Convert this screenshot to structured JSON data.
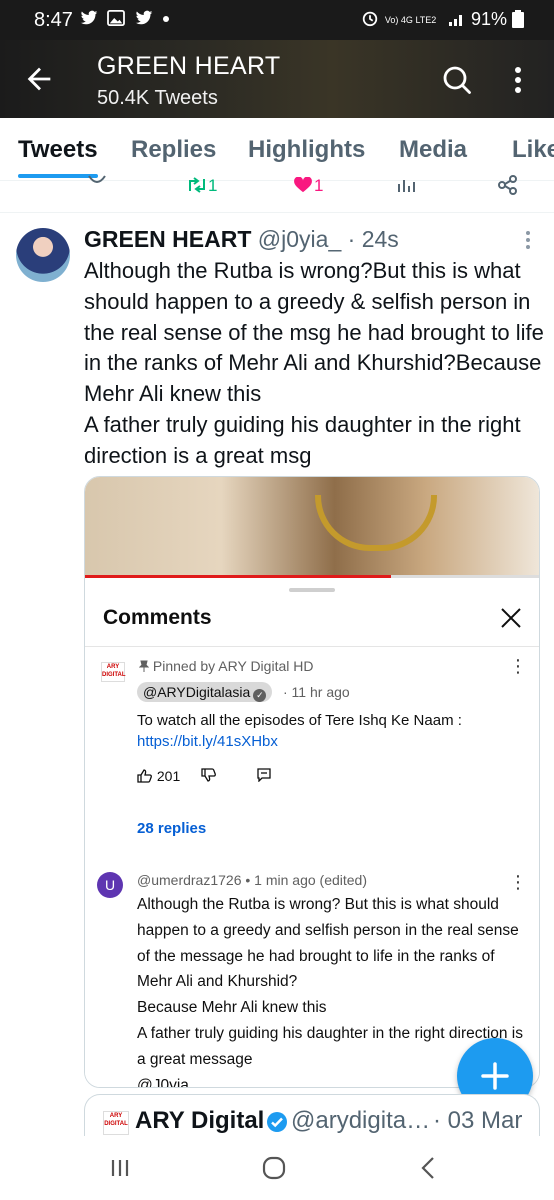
{
  "status_bar": {
    "time": "8:47",
    "notif_icons": [
      "twitter-icon",
      "gallery-icon",
      "twitter-icon",
      "dot-icon"
    ],
    "right": "91%",
    "network": "Vo) 4G LTE2"
  },
  "header": {
    "title": "GREEN HEART",
    "subtitle": "50.4K Tweets"
  },
  "tabs": [
    {
      "label": "Tweets",
      "active": true
    },
    {
      "label": "Replies",
      "active": false
    },
    {
      "label": "Highlights",
      "active": false
    },
    {
      "label": "Media",
      "active": false
    },
    {
      "label": "Likes",
      "active": false
    }
  ],
  "prev_actions": {
    "retweets": "1",
    "likes": "1"
  },
  "tweet": {
    "name": "GREEN HEART",
    "handle": "@j0yia_",
    "time": "· 24s",
    "text": "Although the Rutba is wrong?But this is what should happen to a greedy & selfish person in the real sense of the msg he had brought to life in the ranks of Mehr Ali and Khurshid?Because Mehr Ali knew this\n A father truly guiding his daughter in the right direction is a great msg"
  },
  "comments": {
    "title": "Comments",
    "pinned": {
      "pinned_by": "Pinned by ARY Digital HD",
      "channel": "@ARYDigitalasia",
      "age": "· 11 hr ago",
      "text": "To watch all the episodes of Tere Ishq Ke Naam :",
      "link": "https://bit.ly/41sXHbx",
      "likes": "201",
      "replies": "28 replies"
    },
    "reply": {
      "avatar_letter": "U",
      "header": "@umerdraz1726 • 1 min ago (edited)",
      "text": "Although the Rutba is wrong?  But this is what should happen to a greedy and selfish person in the real sense of the message  he had brought to life in the ranks of Mehr Ali and Khurshid?\nBecause Mehr Ali knew this\n A father truly guiding his daughter in the right direction is a great message\n@J0yia"
    }
  },
  "next_tweet": {
    "name": "ARY Digital",
    "handle": "@arydigita…",
    "date": "· 03 Mar"
  },
  "colors": {
    "accent": "#1d9bf0",
    "like": "#f91880",
    "retweet": "#00ba7c",
    "progress": "#e01b1b"
  }
}
